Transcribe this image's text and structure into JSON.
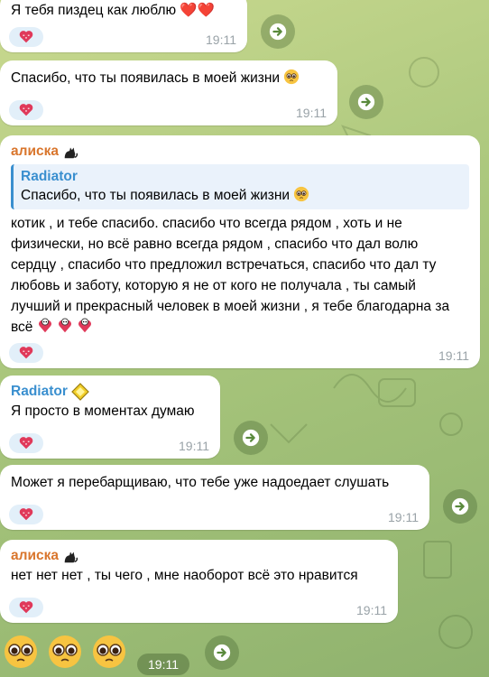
{
  "messages": [
    {
      "text": "Я тебя пиздец как люблю ❤️❤️",
      "time": "19:11"
    },
    {
      "text": "Спасибо, что ты появилась в моей жизни",
      "time": "19:11"
    },
    {
      "sender": "алиска",
      "reply": {
        "name": "Radiator",
        "text": "Спасибо, что ты появилась в моей жизни"
      },
      "text": "котик , и тебе спасибо. спасибо что всегда рядом , хоть и не физически, но всё равно всегда рядом , спасибо что дал волю сердцу , спасибо что предложил встречаться, спасибо что дал ту любовь и заботу, которую я не от кого не получала , ты самый лучший и прекрасный человек в моей жизни , я тебе благодарна за всё",
      "time": "19:11"
    },
    {
      "sender": "Radiator",
      "text": "Я просто в моментах думаю",
      "time": "19:11"
    },
    {
      "text": "Может я перебарщиваю, что тебе уже надоедает слушать",
      "time": "19:11"
    },
    {
      "sender": "алиска",
      "text": "нет нет нет , ты чего , мне наоборот всё это нравится",
      "time": "19:11"
    }
  ],
  "sticker_message": {
    "time": "19:11"
  },
  "icons": {
    "reaction": "heart-reaction-icon",
    "forward": "forward-arrow-icon",
    "cat": "black-cat-icon",
    "badge": "yellow-diamond-badge-icon",
    "pleading": "pleading-face-emoji"
  },
  "colors": {
    "sender_alice": "#d9762d",
    "sender_radiator": "#3a8fcf",
    "bubble": "#ffffff",
    "time": "#9aa3a8"
  }
}
